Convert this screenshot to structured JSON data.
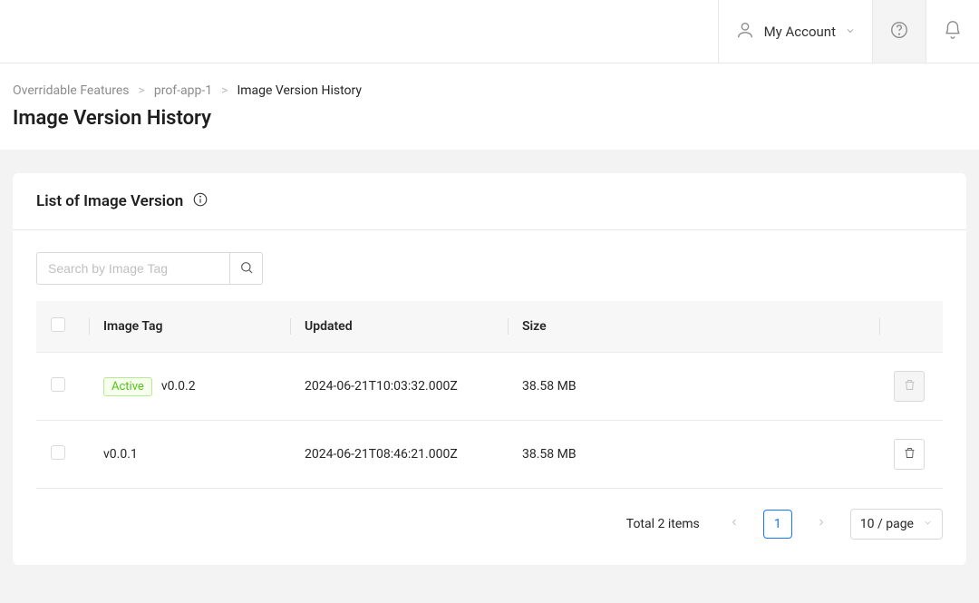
{
  "topbar": {
    "account_label": "My Account"
  },
  "breadcrumbs": {
    "items": [
      {
        "label": "Overridable Features"
      },
      {
        "label": "prof-app-1"
      }
    ],
    "current": "Image Version History"
  },
  "page_title": "Image Version History",
  "card": {
    "title": "List of Image Version"
  },
  "search": {
    "placeholder": "Search by Image Tag"
  },
  "table": {
    "columns": {
      "tag": "Image Tag",
      "updated": "Updated",
      "size": "Size"
    },
    "rows": [
      {
        "badge": "Active",
        "tag": "v0.0.2",
        "updated": "2024-06-21T10:03:32.000Z",
        "size": "38.58 MB",
        "deletable": false
      },
      {
        "badge": null,
        "tag": "v0.0.1",
        "updated": "2024-06-21T08:46:21.000Z",
        "size": "38.58 MB",
        "deletable": true
      }
    ]
  },
  "pagination": {
    "total_text": "Total 2 items",
    "current_page": "1",
    "page_size_label": "10 / page"
  }
}
